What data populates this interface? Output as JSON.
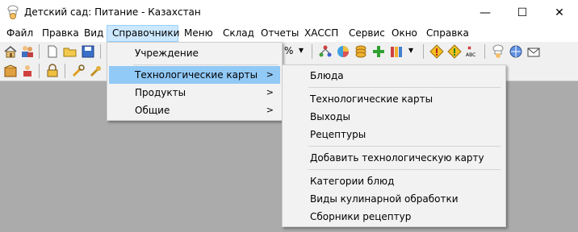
{
  "window": {
    "title": "Детский сад: Питание - Казахстан",
    "minimize_glyph": "—",
    "maximize_glyph": "☐",
    "close_glyph": "✕"
  },
  "menubar": [
    {
      "label": "Файл"
    },
    {
      "label": "Правка"
    },
    {
      "label": "Вид"
    },
    {
      "label": "Справочники",
      "active": true
    },
    {
      "label": "Меню"
    },
    {
      "label": "Склад"
    },
    {
      "label": "Отчеты"
    },
    {
      "label": "ХАССП"
    },
    {
      "label": "Сервис"
    },
    {
      "label": "Окно"
    },
    {
      "label": "Справка"
    }
  ],
  "toolbar": {
    "zoom_text": "%",
    "dropdown_glyph": "▾",
    "abc_text": "ABC"
  },
  "spravochniki_menu": {
    "items": [
      {
        "label": "Учреждение"
      },
      {
        "label": "Технологические карты",
        "submenu_arrow": ">",
        "highlighted": true
      },
      {
        "label": "Продукты",
        "submenu_arrow": ">"
      },
      {
        "label": "Общие",
        "submenu_arrow": ">"
      }
    ]
  },
  "tech_cards_submenu": {
    "groups": [
      [
        "Блюда"
      ],
      [
        "Технологические карты",
        "Выходы",
        "Рецептуры"
      ],
      [
        "Добавить технологическую карту"
      ],
      [
        "Категории блюд",
        "Виды кулинарной обработки",
        "Сборники рецептур"
      ]
    ]
  },
  "colors": {
    "menu_highlight": "#91c9f7",
    "menubar_active": "#cce8ff",
    "workspace": "#abababa"
  }
}
